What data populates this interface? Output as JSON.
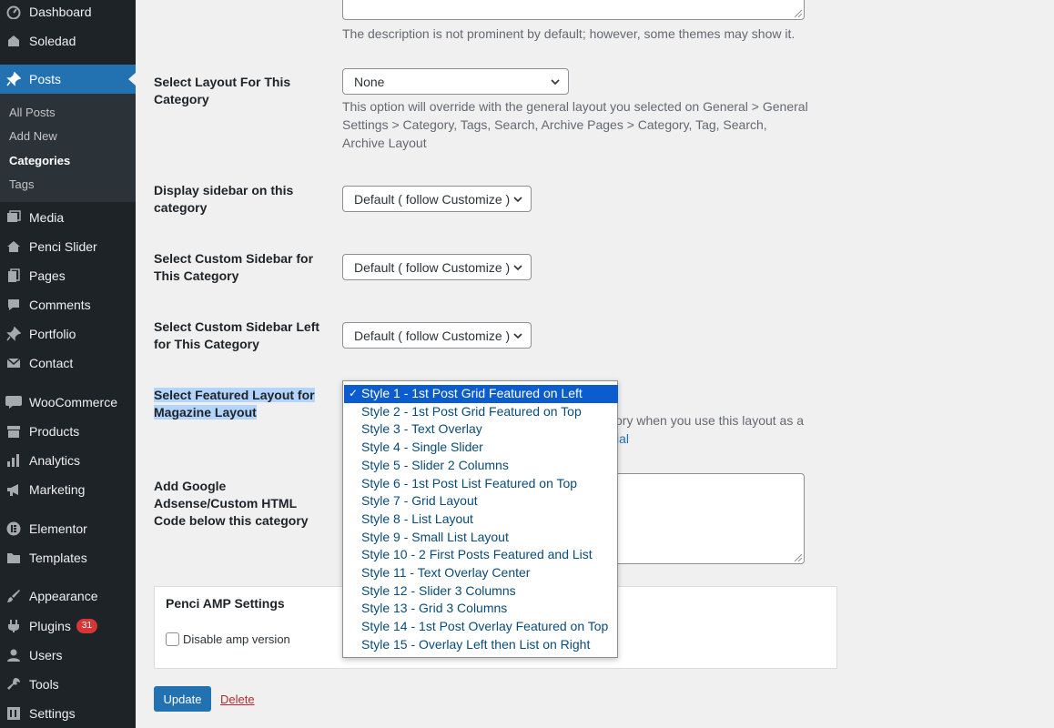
{
  "sidebar": {
    "items": [
      {
        "label": "Dashboard",
        "icon": "dashboard-icon"
      },
      {
        "label": "Soledad",
        "icon": "soledad-icon"
      },
      {
        "label": "Posts",
        "icon": "pushpin-icon"
      },
      {
        "label": "Media",
        "icon": "media-icon"
      },
      {
        "label": "Penci Slider",
        "icon": "home-icon"
      },
      {
        "label": "Pages",
        "icon": "pages-icon"
      },
      {
        "label": "Comments",
        "icon": "comments-icon"
      },
      {
        "label": "Portfolio",
        "icon": "pushpin-icon"
      },
      {
        "label": "Contact",
        "icon": "mail-icon"
      },
      {
        "label": "WooCommerce",
        "icon": "woocommerce-icon"
      },
      {
        "label": "Products",
        "icon": "products-icon"
      },
      {
        "label": "Analytics",
        "icon": "analytics-icon"
      },
      {
        "label": "Marketing",
        "icon": "megaphone-icon"
      },
      {
        "label": "Elementor",
        "icon": "elementor-icon"
      },
      {
        "label": "Templates",
        "icon": "folder-icon"
      },
      {
        "label": "Appearance",
        "icon": "brush-icon"
      },
      {
        "label": "Plugins",
        "icon": "plugin-icon",
        "badge": "31"
      },
      {
        "label": "Users",
        "icon": "user-icon"
      },
      {
        "label": "Tools",
        "icon": "wrench-icon"
      },
      {
        "label": "Settings",
        "icon": "settings-icon"
      }
    ],
    "submenu": [
      "All Posts",
      "Add New",
      "Categories",
      "Tags"
    ]
  },
  "form": {
    "description_help": "The description is not prominent by default; however, some themes may show it.",
    "layout_label": "Select Layout For This Category",
    "layout_value": "None",
    "layout_help": "This option will override with the general layout you selected on General > General Settings > Category, Tags, Search, Archive Pages > Category, Tag, Search, Archive Layout",
    "sidebar_label": "Display sidebar on this category",
    "sidebar_value": "Default ( follow Customize )",
    "custom_sidebar_label": "Select Custom Sidebar for This Category",
    "custom_sidebar_value": "Default ( follow Customize )",
    "custom_sidebar_left_label": "Select Custom Sidebar Left for This Category",
    "custom_sidebar_left_value": "Default ( follow Customize )",
    "featured_label": "Select Featured Layout for Magazine Layout",
    "featured_help_partial": "ory when you use this layout as a",
    "featured_help_link_partial": "ial",
    "adsense_label": "Add Google Adsense/Custom HTML Code below this category",
    "amp_title": "Penci AMP Settings",
    "amp_checkbox_label": "Disable amp version",
    "update_label": "Update",
    "delete_label": "Delete"
  },
  "featured_options": [
    "Style 1 - 1st Post Grid Featured on Left",
    "Style 2 - 1st Post Grid Featured on Top",
    "Style 3 - Text Overlay",
    "Style 4 - Single Slider",
    "Style 5 - Slider 2 Columns",
    "Style 6 - 1st Post List Featured on Top",
    "Style 7 - Grid Layout",
    "Style 8 - List Layout",
    "Style 9 - Small List Layout",
    "Style 10 - 2 First Posts Featured and List",
    "Style 11 - Text Overlay Center",
    "Style 12 - Slider 3 Columns",
    "Style 13 - Grid 3 Columns",
    "Style 14 - 1st Post Overlay Featured on Top",
    "Style 15 - Overlay Left then List on Right"
  ],
  "check_mark": "✓"
}
